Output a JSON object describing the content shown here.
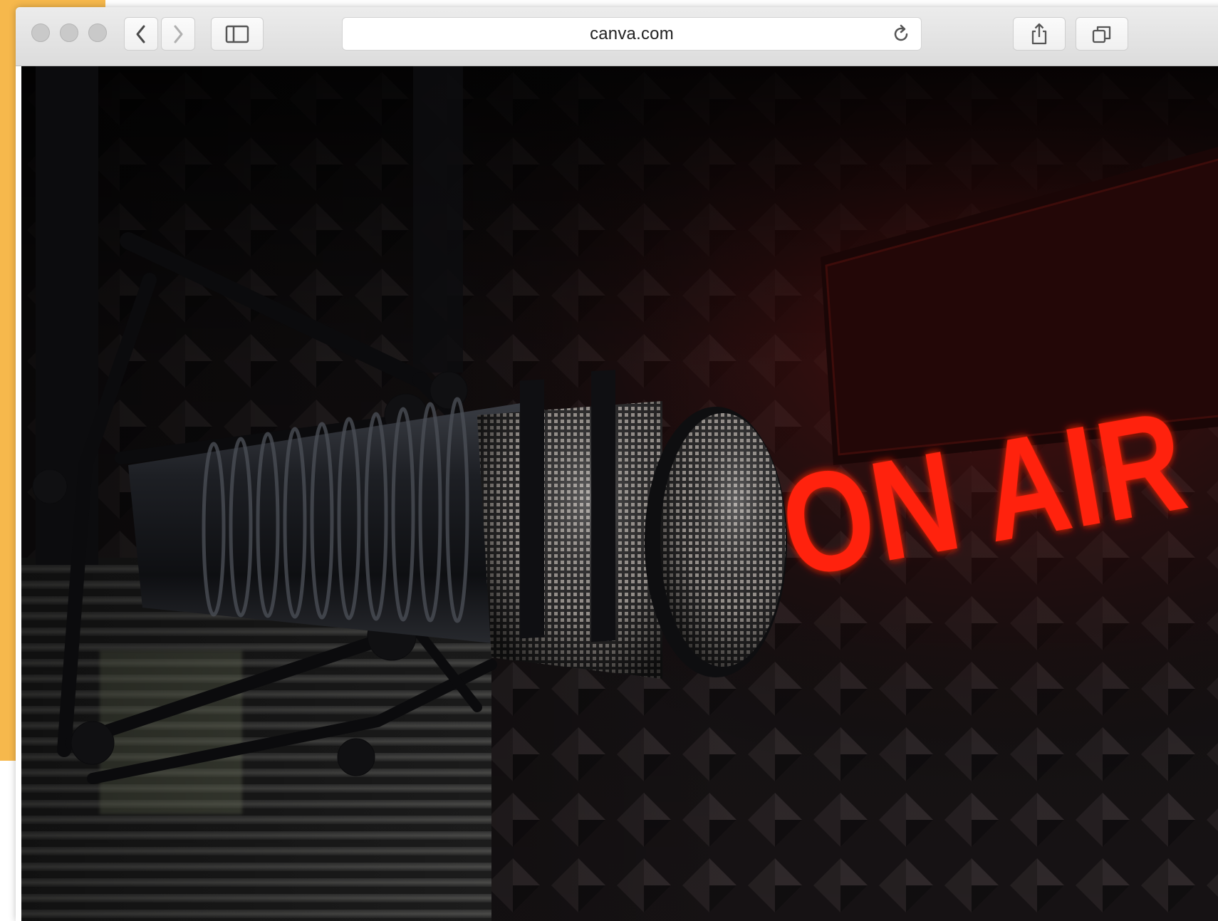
{
  "browser": {
    "url": "canva.com",
    "buttons": {
      "back": "back",
      "forward": "forward",
      "sidebar": "sidebar",
      "reload": "reload",
      "share": "share",
      "tabs": "tabs"
    }
  },
  "photo": {
    "sign_text": "ON AIR",
    "colors": {
      "sign_red": "#ff1a0a",
      "foam": "#2a2426",
      "accent_orange": "#f6b84c"
    }
  }
}
